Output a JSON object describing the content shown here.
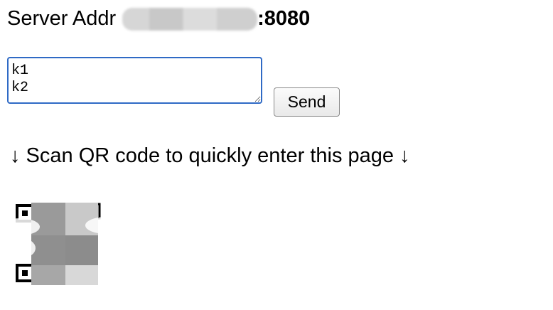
{
  "server": {
    "label": "Server Addr",
    "port_suffix": ":8080"
  },
  "message_input": {
    "value": "k1\nk2"
  },
  "send_button": {
    "label": "Send"
  },
  "hint": {
    "text": "↓ Scan QR code to quickly enter this page ↓"
  },
  "qr": {
    "icon": "qr-code-icon"
  }
}
